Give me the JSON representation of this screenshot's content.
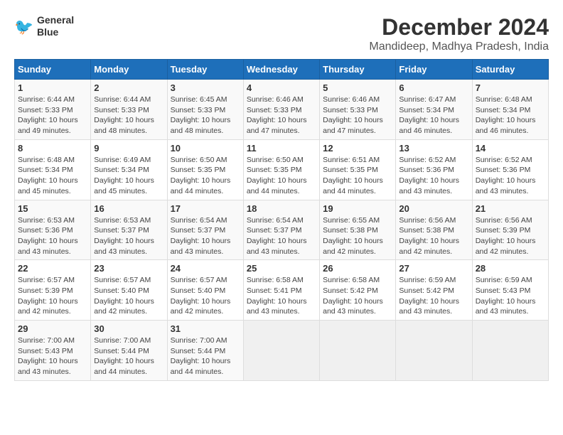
{
  "logo": {
    "line1": "General",
    "line2": "Blue"
  },
  "title": "December 2024",
  "subtitle": "Mandideep, Madhya Pradesh, India",
  "weekdays": [
    "Sunday",
    "Monday",
    "Tuesday",
    "Wednesday",
    "Thursday",
    "Friday",
    "Saturday"
  ],
  "weeks": [
    [
      {
        "day": "1",
        "info": "Sunrise: 6:44 AM\nSunset: 5:33 PM\nDaylight: 10 hours\nand 49 minutes."
      },
      {
        "day": "2",
        "info": "Sunrise: 6:44 AM\nSunset: 5:33 PM\nDaylight: 10 hours\nand 48 minutes."
      },
      {
        "day": "3",
        "info": "Sunrise: 6:45 AM\nSunset: 5:33 PM\nDaylight: 10 hours\nand 48 minutes."
      },
      {
        "day": "4",
        "info": "Sunrise: 6:46 AM\nSunset: 5:33 PM\nDaylight: 10 hours\nand 47 minutes."
      },
      {
        "day": "5",
        "info": "Sunrise: 6:46 AM\nSunset: 5:33 PM\nDaylight: 10 hours\nand 47 minutes."
      },
      {
        "day": "6",
        "info": "Sunrise: 6:47 AM\nSunset: 5:34 PM\nDaylight: 10 hours\nand 46 minutes."
      },
      {
        "day": "7",
        "info": "Sunrise: 6:48 AM\nSunset: 5:34 PM\nDaylight: 10 hours\nand 46 minutes."
      }
    ],
    [
      {
        "day": "8",
        "info": "Sunrise: 6:48 AM\nSunset: 5:34 PM\nDaylight: 10 hours\nand 45 minutes."
      },
      {
        "day": "9",
        "info": "Sunrise: 6:49 AM\nSunset: 5:34 PM\nDaylight: 10 hours\nand 45 minutes."
      },
      {
        "day": "10",
        "info": "Sunrise: 6:50 AM\nSunset: 5:35 PM\nDaylight: 10 hours\nand 44 minutes."
      },
      {
        "day": "11",
        "info": "Sunrise: 6:50 AM\nSunset: 5:35 PM\nDaylight: 10 hours\nand 44 minutes."
      },
      {
        "day": "12",
        "info": "Sunrise: 6:51 AM\nSunset: 5:35 PM\nDaylight: 10 hours\nand 44 minutes."
      },
      {
        "day": "13",
        "info": "Sunrise: 6:52 AM\nSunset: 5:36 PM\nDaylight: 10 hours\nand 43 minutes."
      },
      {
        "day": "14",
        "info": "Sunrise: 6:52 AM\nSunset: 5:36 PM\nDaylight: 10 hours\nand 43 minutes."
      }
    ],
    [
      {
        "day": "15",
        "info": "Sunrise: 6:53 AM\nSunset: 5:36 PM\nDaylight: 10 hours\nand 43 minutes."
      },
      {
        "day": "16",
        "info": "Sunrise: 6:53 AM\nSunset: 5:37 PM\nDaylight: 10 hours\nand 43 minutes."
      },
      {
        "day": "17",
        "info": "Sunrise: 6:54 AM\nSunset: 5:37 PM\nDaylight: 10 hours\nand 43 minutes."
      },
      {
        "day": "18",
        "info": "Sunrise: 6:54 AM\nSunset: 5:37 PM\nDaylight: 10 hours\nand 43 minutes."
      },
      {
        "day": "19",
        "info": "Sunrise: 6:55 AM\nSunset: 5:38 PM\nDaylight: 10 hours\nand 42 minutes."
      },
      {
        "day": "20",
        "info": "Sunrise: 6:56 AM\nSunset: 5:38 PM\nDaylight: 10 hours\nand 42 minutes."
      },
      {
        "day": "21",
        "info": "Sunrise: 6:56 AM\nSunset: 5:39 PM\nDaylight: 10 hours\nand 42 minutes."
      }
    ],
    [
      {
        "day": "22",
        "info": "Sunrise: 6:57 AM\nSunset: 5:39 PM\nDaylight: 10 hours\nand 42 minutes."
      },
      {
        "day": "23",
        "info": "Sunrise: 6:57 AM\nSunset: 5:40 PM\nDaylight: 10 hours\nand 42 minutes."
      },
      {
        "day": "24",
        "info": "Sunrise: 6:57 AM\nSunset: 5:40 PM\nDaylight: 10 hours\nand 42 minutes."
      },
      {
        "day": "25",
        "info": "Sunrise: 6:58 AM\nSunset: 5:41 PM\nDaylight: 10 hours\nand 43 minutes."
      },
      {
        "day": "26",
        "info": "Sunrise: 6:58 AM\nSunset: 5:42 PM\nDaylight: 10 hours\nand 43 minutes."
      },
      {
        "day": "27",
        "info": "Sunrise: 6:59 AM\nSunset: 5:42 PM\nDaylight: 10 hours\nand 43 minutes."
      },
      {
        "day": "28",
        "info": "Sunrise: 6:59 AM\nSunset: 5:43 PM\nDaylight: 10 hours\nand 43 minutes."
      }
    ],
    [
      {
        "day": "29",
        "info": "Sunrise: 7:00 AM\nSunset: 5:43 PM\nDaylight: 10 hours\nand 43 minutes."
      },
      {
        "day": "30",
        "info": "Sunrise: 7:00 AM\nSunset: 5:44 PM\nDaylight: 10 hours\nand 44 minutes."
      },
      {
        "day": "31",
        "info": "Sunrise: 7:00 AM\nSunset: 5:44 PM\nDaylight: 10 hours\nand 44 minutes."
      },
      {
        "day": "",
        "info": ""
      },
      {
        "day": "",
        "info": ""
      },
      {
        "day": "",
        "info": ""
      },
      {
        "day": "",
        "info": ""
      }
    ]
  ]
}
